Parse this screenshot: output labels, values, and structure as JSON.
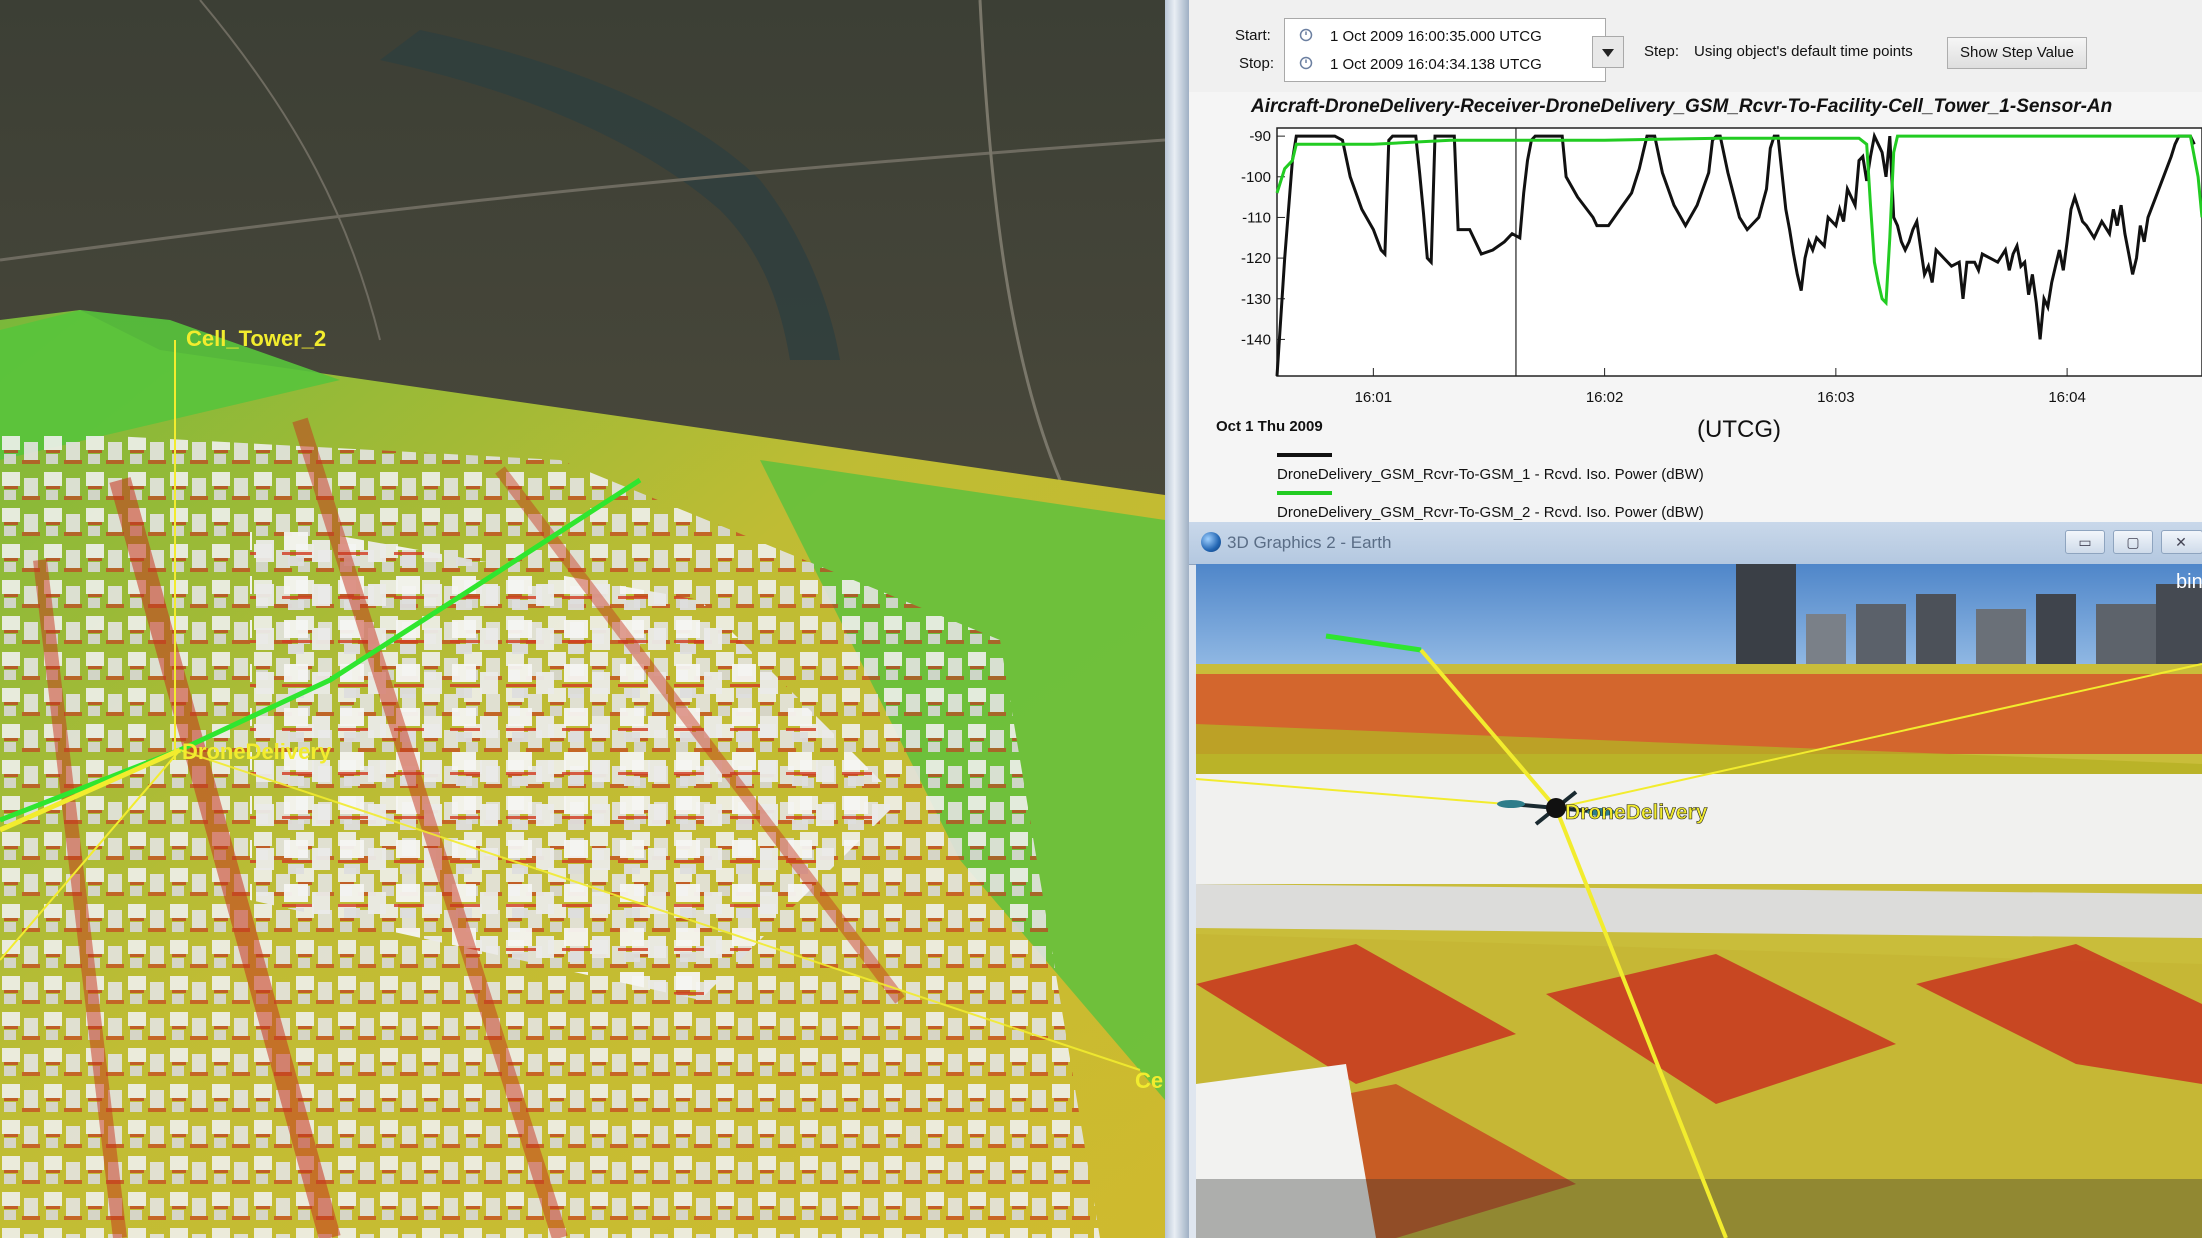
{
  "left_view": {
    "labels": {
      "tower2": "Cell_Tower_2",
      "drone": "DroneDelivery",
      "tower_partial": "Ce"
    }
  },
  "report": {
    "start_label": "Start:",
    "stop_label": "Stop:",
    "start_value": "1 Oct 2009 16:00:35.000 UTCG",
    "stop_value": "1 Oct 2009 16:04:34.138 UTCG",
    "step_label": "Step:",
    "step_value": "Using object's default time points",
    "show_step_button": "Show Step Value"
  },
  "chart_data": {
    "type": "line",
    "title": "Aircraft-DroneDelivery-Receiver-DroneDelivery_GSM_Rcvr-To-Facility-Cell_Tower_1-Sensor-An",
    "xlabel": "(UTCG)",
    "x_start_label": "Oct 1 Thu 2009",
    "x_ticks": [
      "16:01",
      "16:02",
      "16:03",
      "16:04"
    ],
    "y_ticks": [
      "-90",
      "-100",
      "-110",
      "-120",
      "-130",
      "-140"
    ],
    "ylim": [
      -150,
      -90
    ],
    "xlim_seconds": [
      35,
      275
    ],
    "cursor_seconds": 97,
    "series": [
      {
        "name": "DroneDelivery_GSM_Rcvr-To-GSM_1 - Rcvd. Iso. Power (dBW)",
        "color": "#111111",
        "points": [
          [
            35,
            -149
          ],
          [
            37,
            -120
          ],
          [
            39,
            -96
          ],
          [
            40,
            -90
          ],
          [
            50,
            -90
          ],
          [
            52,
            -91
          ],
          [
            54,
            -100
          ],
          [
            57,
            -108
          ],
          [
            60,
            -113
          ],
          [
            62,
            -118
          ],
          [
            63,
            -119
          ],
          [
            64,
            -91
          ],
          [
            65,
            -90
          ],
          [
            71,
            -90
          ],
          [
            72,
            -99
          ],
          [
            73,
            -109
          ],
          [
            74,
            -120
          ],
          [
            75,
            -121
          ],
          [
            76,
            -90
          ],
          [
            81,
            -90
          ],
          [
            82,
            -113
          ],
          [
            85,
            -113
          ],
          [
            88,
            -119
          ],
          [
            91,
            -118
          ],
          [
            94,
            -116
          ],
          [
            96,
            -114
          ],
          [
            98,
            -115
          ],
          [
            99,
            -104
          ],
          [
            100,
            -96
          ],
          [
            101,
            -91
          ],
          [
            102,
            -90
          ],
          [
            109,
            -90
          ],
          [
            110,
            -100
          ],
          [
            113,
            -105
          ],
          [
            117,
            -110
          ],
          [
            118,
            -112
          ],
          [
            121,
            -112
          ],
          [
            124,
            -108
          ],
          [
            127,
            -104
          ],
          [
            129,
            -98
          ],
          [
            130,
            -94
          ],
          [
            131,
            -90
          ],
          [
            133,
            -90
          ],
          [
            135,
            -99
          ],
          [
            138,
            -107
          ],
          [
            141,
            -112
          ],
          [
            144,
            -107
          ],
          [
            147,
            -99
          ],
          [
            148,
            -91
          ],
          [
            149,
            -90
          ],
          [
            150,
            -90
          ],
          [
            152,
            -99
          ],
          [
            155,
            -110
          ],
          [
            157,
            -113
          ],
          [
            160,
            -110
          ],
          [
            162,
            -103
          ],
          [
            163,
            -93
          ],
          [
            164,
            -90
          ],
          [
            165,
            -90
          ],
          [
            166,
            -99
          ],
          [
            167,
            -108
          ],
          [
            168,
            -113
          ],
          [
            169,
            -119
          ],
          [
            170,
            -124
          ],
          [
            171,
            -128
          ],
          [
            172,
            -120
          ],
          [
            173,
            -116
          ],
          [
            174,
            -118
          ],
          [
            175,
            -115
          ],
          [
            177,
            -117
          ],
          [
            178,
            -110
          ],
          [
            180,
            -112
          ],
          [
            181,
            -108
          ],
          [
            182,
            -111
          ],
          [
            183,
            -103
          ],
          [
            185,
            -107
          ],
          [
            186,
            -96
          ],
          [
            187,
            -95
          ],
          [
            188,
            -101
          ],
          [
            189,
            -95
          ],
          [
            190,
            -90
          ],
          [
            191,
            -92
          ],
          [
            192,
            -94
          ],
          [
            193,
            -100
          ],
          [
            194,
            -90
          ],
          [
            195,
            -110
          ],
          [
            196,
            -112
          ],
          [
            197,
            -116
          ],
          [
            198,
            -118
          ],
          [
            199,
            -116
          ],
          [
            200,
            -113
          ],
          [
            201,
            -111
          ],
          [
            203,
            -124
          ],
          [
            204,
            -122
          ],
          [
            205,
            -126
          ],
          [
            206,
            -118
          ],
          [
            208,
            -120
          ],
          [
            210,
            -122
          ],
          [
            212,
            -121
          ],
          [
            213,
            -130
          ],
          [
            214,
            -121
          ],
          [
            216,
            -121
          ],
          [
            217,
            -123
          ],
          [
            218,
            -119
          ],
          [
            220,
            -120
          ],
          [
            222,
            -121
          ],
          [
            224,
            -118
          ],
          [
            225,
            -123
          ],
          [
            226,
            -119
          ],
          [
            227,
            -117
          ],
          [
            228,
            -122
          ],
          [
            229,
            -121
          ],
          [
            230,
            -129
          ],
          [
            231,
            -124
          ],
          [
            232,
            -131
          ],
          [
            233,
            -140
          ],
          [
            234,
            -130
          ],
          [
            235,
            -132
          ],
          [
            236,
            -126
          ],
          [
            237,
            -122
          ],
          [
            238,
            -118
          ],
          [
            239,
            -123
          ],
          [
            240,
            -116
          ],
          [
            241,
            -108
          ],
          [
            242,
            -105
          ],
          [
            244,
            -111
          ],
          [
            245,
            -112
          ],
          [
            247,
            -115
          ],
          [
            249,
            -111
          ],
          [
            251,
            -114
          ],
          [
            252,
            -108
          ],
          [
            253,
            -112
          ],
          [
            254,
            -107
          ],
          [
            255,
            -114
          ],
          [
            256,
            -119
          ],
          [
            257,
            -124
          ],
          [
            258,
            -120
          ],
          [
            259,
            -112
          ],
          [
            260,
            -116
          ],
          [
            261,
            -110
          ],
          [
            263,
            -105
          ],
          [
            265,
            -100
          ],
          [
            267,
            -95
          ],
          [
            268,
            -92
          ],
          [
            269,
            -90
          ],
          [
            272,
            -90
          ],
          [
            273,
            -92
          ]
        ]
      },
      {
        "name": "DroneDelivery_GSM_Rcvr-To-GSM_2 - Rcvd. Iso. Power (dBW)",
        "color": "#22cc22",
        "points": [
          [
            35,
            -104
          ],
          [
            37,
            -98
          ],
          [
            39,
            -96
          ],
          [
            40,
            -92
          ],
          [
            60,
            -92
          ],
          [
            80,
            -91
          ],
          [
            120,
            -91
          ],
          [
            150,
            -90.5
          ],
          [
            186,
            -90.5
          ],
          [
            188,
            -92
          ],
          [
            189,
            -107
          ],
          [
            190,
            -121
          ],
          [
            191,
            -126
          ],
          [
            192,
            -130
          ],
          [
            193,
            -131
          ],
          [
            194,
            -115
          ],
          [
            195,
            -94
          ],
          [
            196,
            -90
          ],
          [
            230,
            -90
          ],
          [
            272,
            -90
          ],
          [
            274,
            -100
          ],
          [
            275,
            -110
          ]
        ]
      }
    ]
  },
  "graphics2": {
    "title": "3D Graphics 2 - Earth",
    "drone_label": "DroneDelivery",
    "watermark": "bing",
    "btn_minimize": "▭",
    "btn_restore": "▢",
    "btn_close": "✕"
  }
}
